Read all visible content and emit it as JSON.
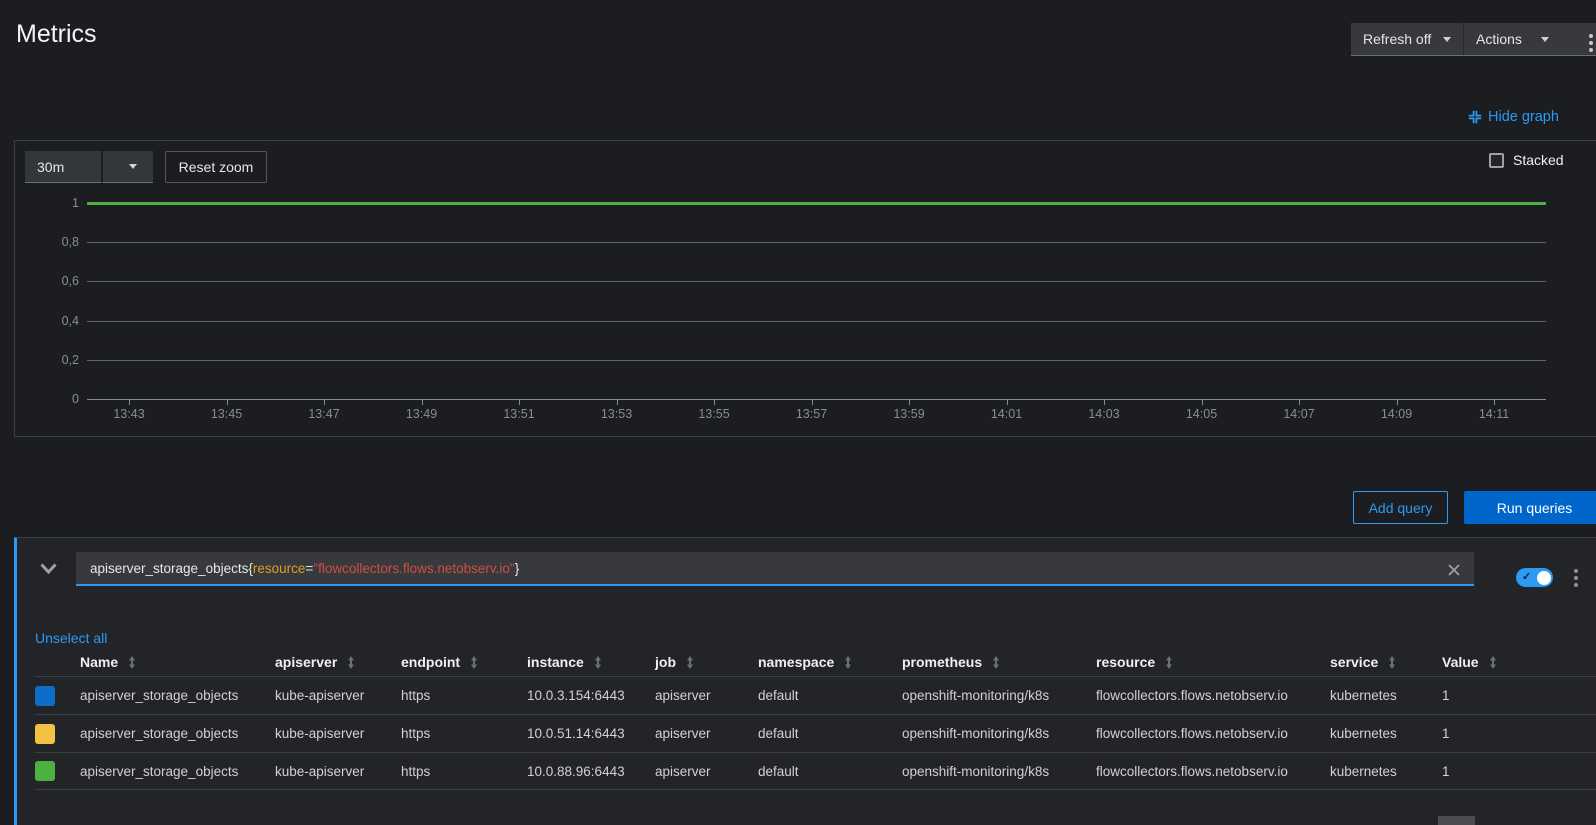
{
  "page": {
    "title": "Metrics"
  },
  "toolbar": {
    "refresh_label": "Refresh off",
    "actions_label": "Actions"
  },
  "graph_controls": {
    "hide_graph_label": "Hide graph",
    "timespan_value": "30m",
    "reset_zoom_label": "Reset zoom",
    "stacked_label": "Stacked",
    "stacked_checked": false
  },
  "chart_data": {
    "type": "line",
    "title": "",
    "xlabel": "",
    "ylabel": "",
    "ylim": [
      0,
      1
    ],
    "grid": true,
    "legend_position": "none",
    "x": [
      "13:43",
      "13:45",
      "13:47",
      "13:49",
      "13:51",
      "13:53",
      "13:55",
      "13:57",
      "13:59",
      "14:01",
      "14:03",
      "14:05",
      "14:07",
      "14:09",
      "14:11"
    ],
    "y_ticks": [
      "0",
      "0,2",
      "0,4",
      "0,6",
      "0,8",
      "1"
    ],
    "series": [
      {
        "name": "apiserver_storage_objects 10.0.3.154:6443",
        "color": "#0d6ec9",
        "values": [
          1,
          1,
          1,
          1,
          1,
          1,
          1,
          1,
          1,
          1,
          1,
          1,
          1,
          1,
          1
        ]
      },
      {
        "name": "apiserver_storage_objects 10.0.51.14:6443",
        "color": "#f4c145",
        "values": [
          1,
          1,
          1,
          1,
          1,
          1,
          1,
          1,
          1,
          1,
          1,
          1,
          1,
          1,
          1
        ]
      },
      {
        "name": "apiserver_storage_objects 10.0.88.96:6443",
        "color": "#4cb140",
        "values": [
          1,
          1,
          1,
          1,
          1,
          1,
          1,
          1,
          1,
          1,
          1,
          1,
          1,
          1,
          1
        ]
      }
    ]
  },
  "query_actions": {
    "add_query_label": "Add query",
    "run_queries_label": "Run queries"
  },
  "query": {
    "expression": "apiserver_storage_objects{resource=\"flowcollectors.flows.netobserv.io\"}",
    "segments": [
      {
        "text": "apiserver_storage_objects",
        "role": "metric"
      },
      {
        "text": "{",
        "role": "punct"
      },
      {
        "text": "resource",
        "role": "label"
      },
      {
        "text": "=",
        "role": "punct"
      },
      {
        "text": "\"flowcollectors.flows.netobserv.io\"",
        "role": "string"
      },
      {
        "text": "}",
        "role": "punct"
      }
    ],
    "enabled": true,
    "unselect_all_label": "Unselect all"
  },
  "table": {
    "columns": [
      "Name",
      "apiserver",
      "endpoint",
      "instance",
      "job",
      "namespace",
      "prometheus",
      "resource",
      "service",
      "Value"
    ],
    "rows": [
      {
        "color": "#0d6ec9",
        "cells": [
          "apiserver_storage_objects",
          "kube-apiserver",
          "https",
          "10.0.3.154:6443",
          "apiserver",
          "default",
          "openshift-monitoring/k8s",
          "flowcollectors.flows.netobserv.io",
          "kubernetes",
          "1"
        ]
      },
      {
        "color": "#f4c145",
        "cells": [
          "apiserver_storage_objects",
          "kube-apiserver",
          "https",
          "10.0.51.14:6443",
          "apiserver",
          "default",
          "openshift-monitoring/k8s",
          "flowcollectors.flows.netobserv.io",
          "kubernetes",
          "1"
        ]
      },
      {
        "color": "#4cb140",
        "cells": [
          "apiserver_storage_objects",
          "kube-apiserver",
          "https",
          "10.0.88.96:6443",
          "apiserver",
          "default",
          "openshift-monitoring/k8s",
          "flowcollectors.flows.netobserv.io",
          "kubernetes",
          "1"
        ]
      }
    ]
  },
  "colors": {
    "accent": "#2b9af3",
    "primary_button": "#0066cc",
    "background": "#1b1d21",
    "panel": "#222428"
  }
}
